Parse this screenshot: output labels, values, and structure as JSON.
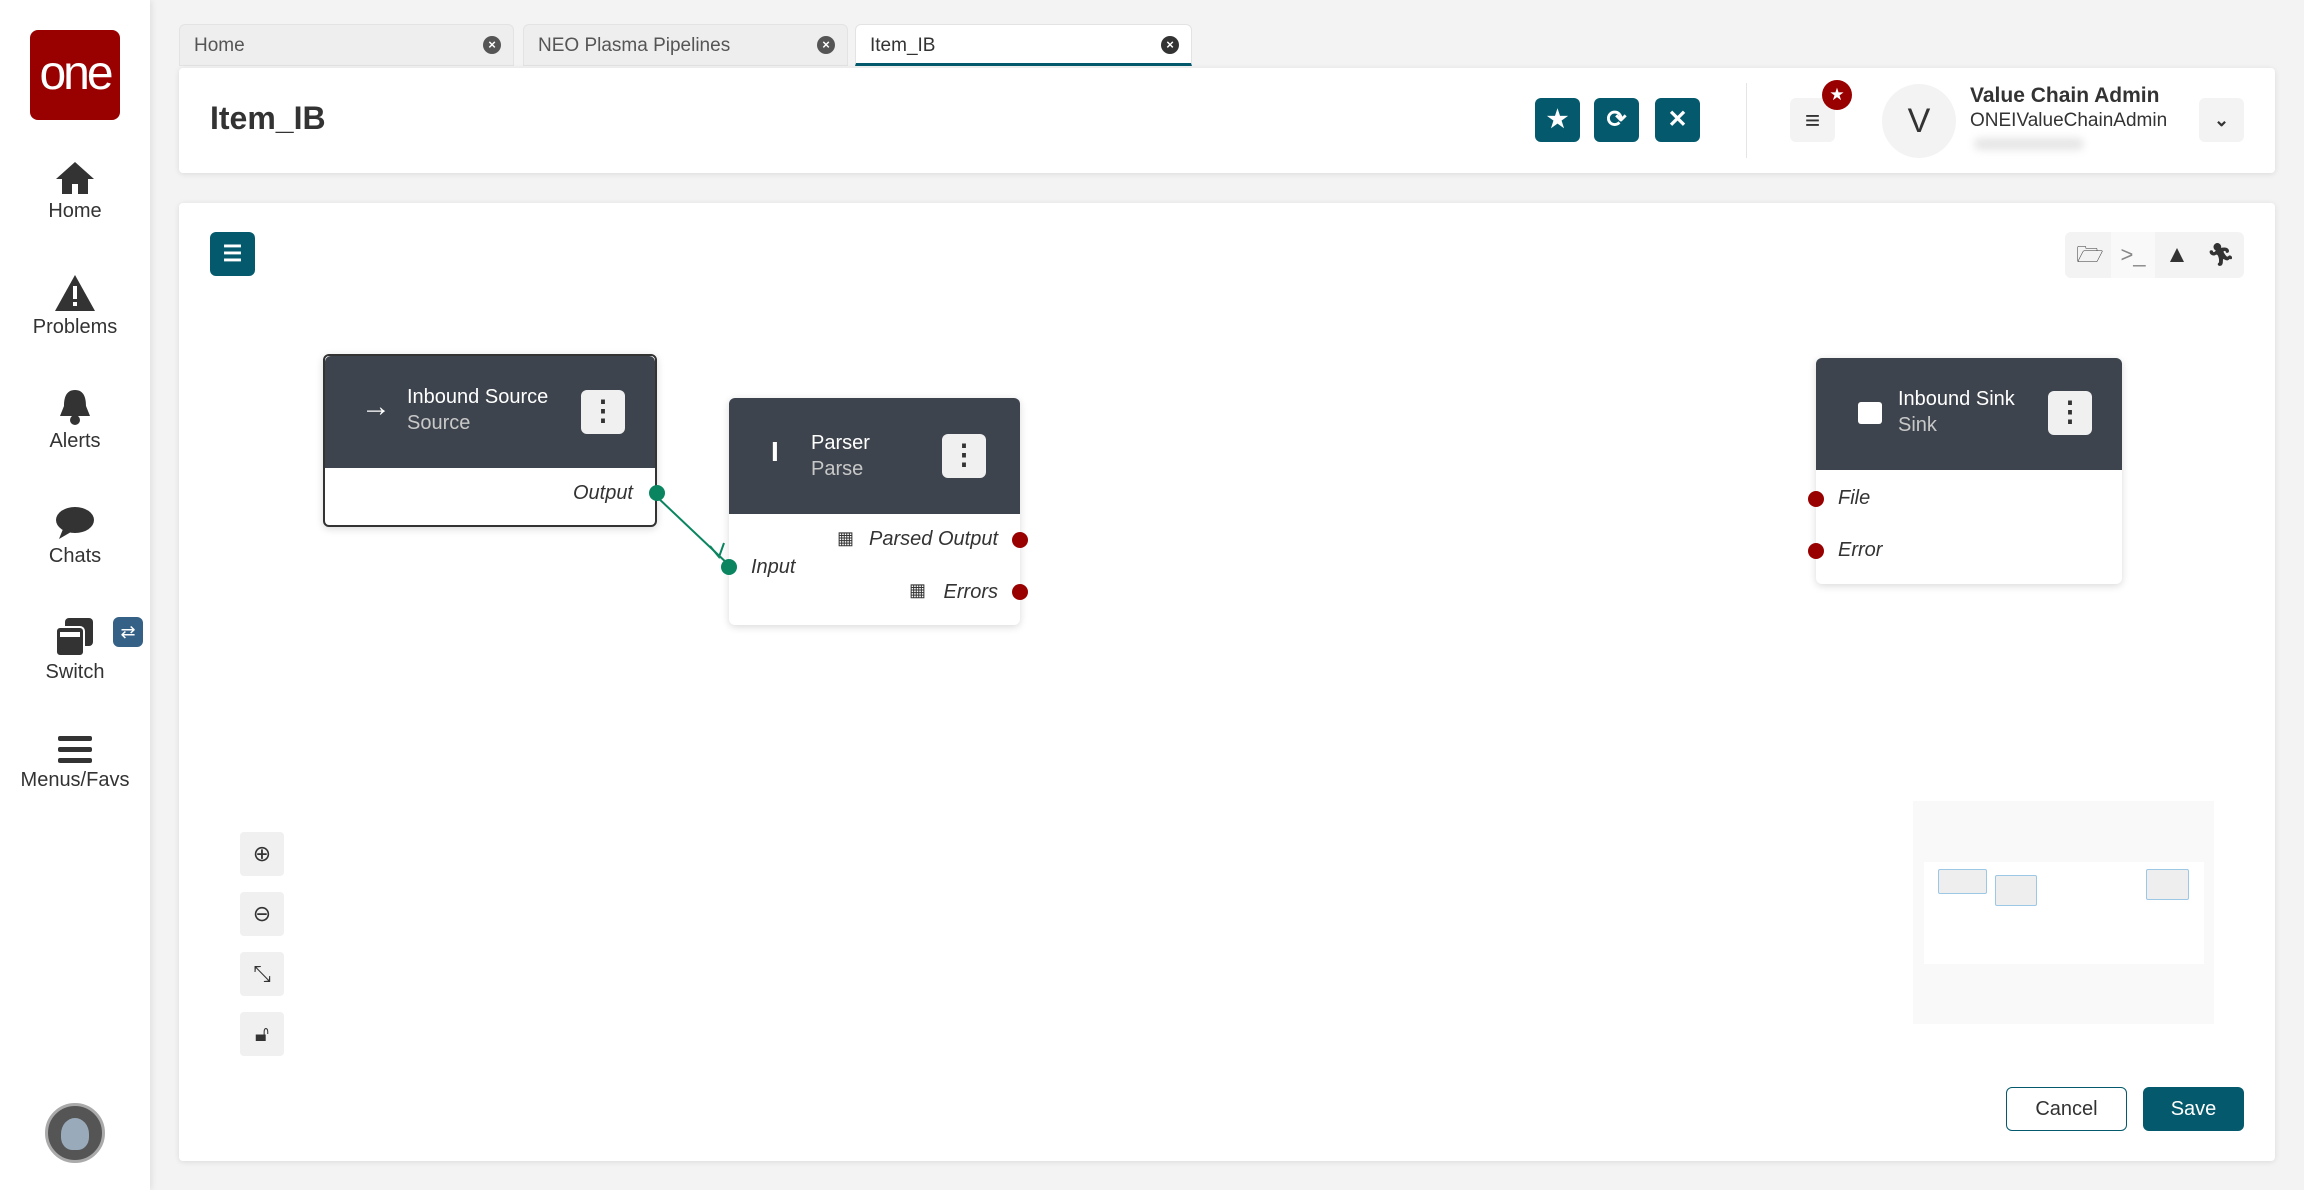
{
  "sidebar": {
    "logo": "one",
    "items": [
      {
        "label": "Home",
        "icon": "home-icon"
      },
      {
        "label": "Problems",
        "icon": "warning-icon"
      },
      {
        "label": "Alerts",
        "icon": "bell-icon"
      },
      {
        "label": "Chats",
        "icon": "chat-icon"
      },
      {
        "label": "Switch",
        "icon": "windows-icon"
      },
      {
        "label": "Menus/Favs",
        "icon": "hamburger-icon"
      }
    ]
  },
  "tabs": [
    {
      "label": "Home"
    },
    {
      "label": "NEO Plasma Pipelines"
    },
    {
      "label": "Item_IB",
      "active": true
    }
  ],
  "header": {
    "title": "Item_IB",
    "user_name": "Value Chain Admin",
    "user_id": "ONEIValueChainAdmin",
    "avatar_letter": "V"
  },
  "nodes": [
    {
      "title": "Inbound Source",
      "subtitle": "Source",
      "outputs": [
        "Output"
      ]
    },
    {
      "title": "Parser",
      "subtitle": "Parse",
      "inputs": [
        "Input"
      ],
      "outputs": [
        "Parsed Output",
        "Errors"
      ]
    },
    {
      "title": "Inbound Sink",
      "subtitle": "Sink",
      "inputs": [
        "File",
        "Error"
      ]
    }
  ],
  "footer": {
    "cancel": "Cancel",
    "save": "Save"
  },
  "colors": {
    "accent": "#045a6c",
    "brand": "#990000",
    "node_header": "#3e444d",
    "port_connected": "#0a8560",
    "port_open": "#990000"
  }
}
